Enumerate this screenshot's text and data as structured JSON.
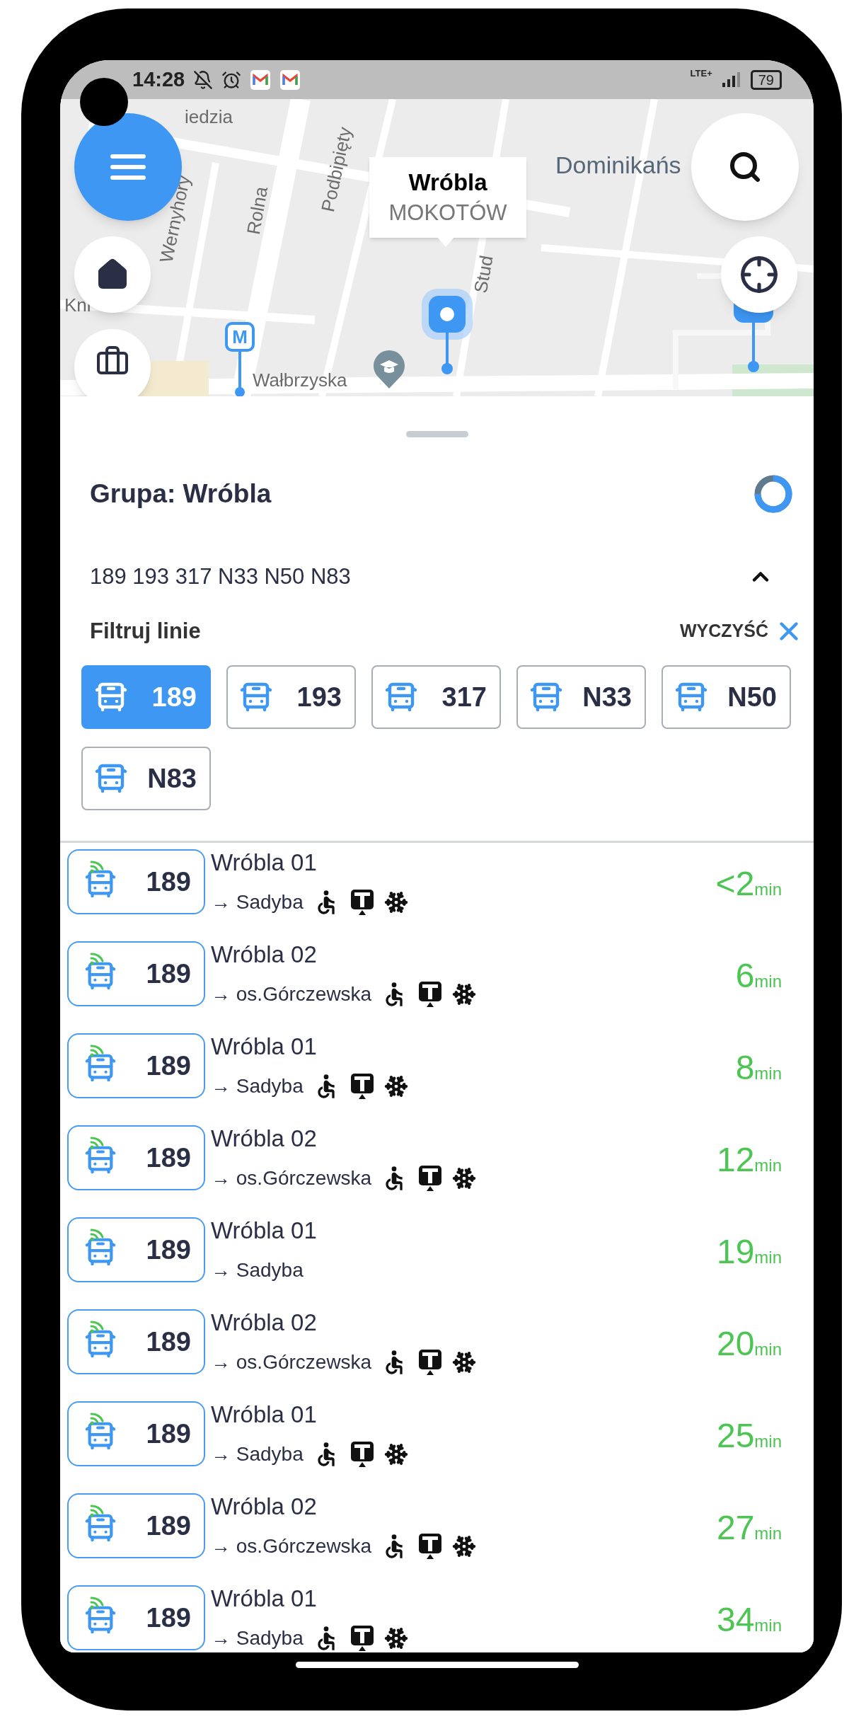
{
  "status_bar": {
    "time": "14:28",
    "network": "LTE+",
    "battery": "79"
  },
  "map": {
    "street_labels": [
      {
        "text": "iedzia"
      },
      {
        "text": "Wernyhory"
      },
      {
        "text": "Rolna"
      },
      {
        "text": "Podbipięty"
      },
      {
        "text": "Dominikańs"
      },
      {
        "text": "Stud"
      },
      {
        "text": "Kni"
      },
      {
        "text": "Wałbrzyska"
      }
    ],
    "popup": {
      "title": "Wróbla",
      "district": "MOKOTÓW"
    },
    "metro_marker": "M"
  },
  "sheet": {
    "title": "Grupa: Wróbla",
    "lines_summary": "189 193 317 N33 N50 N83",
    "expanded": true,
    "filter_label": "Filtruj linie",
    "clear_label": "WYCZYŚĆ",
    "chips": [
      {
        "label": "189",
        "selected": true
      },
      {
        "label": "193",
        "selected": false
      },
      {
        "label": "317",
        "selected": false
      },
      {
        "label": "N33",
        "selected": false
      },
      {
        "label": "N50",
        "selected": false
      },
      {
        "label": "N83",
        "selected": false
      }
    ]
  },
  "departures": [
    {
      "line": "189",
      "realtime": true,
      "stop": "Wróbla 01",
      "direction": "→ Sadyba",
      "wheelchair": true,
      "ticket_machine": true,
      "air_conditioning": true,
      "time": "<2",
      "unit": "min"
    },
    {
      "line": "189",
      "realtime": true,
      "stop": "Wróbla 02",
      "direction": "→ os.Górczewska",
      "wheelchair": true,
      "ticket_machine": true,
      "air_conditioning": true,
      "time": "6",
      "unit": "min"
    },
    {
      "line": "189",
      "realtime": true,
      "stop": "Wróbla 01",
      "direction": "→ Sadyba",
      "wheelchair": true,
      "ticket_machine": true,
      "air_conditioning": true,
      "time": "8",
      "unit": "min"
    },
    {
      "line": "189",
      "realtime": true,
      "stop": "Wróbla 02",
      "direction": "→ os.Górczewska",
      "wheelchair": true,
      "ticket_machine": true,
      "air_conditioning": true,
      "time": "12",
      "unit": "min"
    },
    {
      "line": "189",
      "realtime": true,
      "stop": "Wróbla 01",
      "direction": "→ Sadyba",
      "wheelchair": false,
      "ticket_machine": false,
      "air_conditioning": false,
      "time": "19",
      "unit": "min"
    },
    {
      "line": "189",
      "realtime": true,
      "stop": "Wróbla 02",
      "direction": "→ os.Górczewska",
      "wheelchair": true,
      "ticket_machine": true,
      "air_conditioning": true,
      "time": "20",
      "unit": "min"
    },
    {
      "line": "189",
      "realtime": true,
      "stop": "Wróbla 01",
      "direction": "→ Sadyba",
      "wheelchair": true,
      "ticket_machine": true,
      "air_conditioning": true,
      "time": "25",
      "unit": "min"
    },
    {
      "line": "189",
      "realtime": true,
      "stop": "Wróbla 02",
      "direction": "→ os.Górczewska",
      "wheelchair": true,
      "ticket_machine": true,
      "air_conditioning": true,
      "time": "27",
      "unit": "min"
    },
    {
      "line": "189",
      "realtime": true,
      "stop": "Wróbla 01",
      "direction": "→ Sadyba",
      "wheelchair": true,
      "ticket_machine": true,
      "air_conditioning": true,
      "time": "34",
      "unit": "min"
    }
  ]
}
